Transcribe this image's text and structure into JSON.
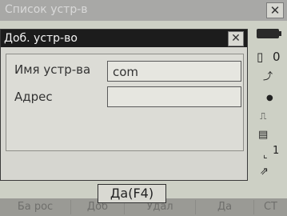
{
  "bg_window": {
    "title": "Список устр-в",
    "close_icon": "close-icon",
    "status_icons": [
      "battery-icon",
      "signal-icon",
      "compensator-icon",
      "prism-icon",
      "memory-icon",
      "level-icon",
      "page-icon"
    ],
    "status_texts": [
      "0",
      "1"
    ],
    "softkeys": [
      "Ба рос",
      "Доб",
      "Удал",
      "Да",
      "СТ"
    ]
  },
  "dialog": {
    "title": "Доб. устр-во",
    "close_icon": "close-icon",
    "fields": [
      {
        "label": "Имя устр-ва",
        "value": "com"
      },
      {
        "label": "Адрес",
        "value": ""
      }
    ],
    "ok_label": "Да(F4)"
  }
}
